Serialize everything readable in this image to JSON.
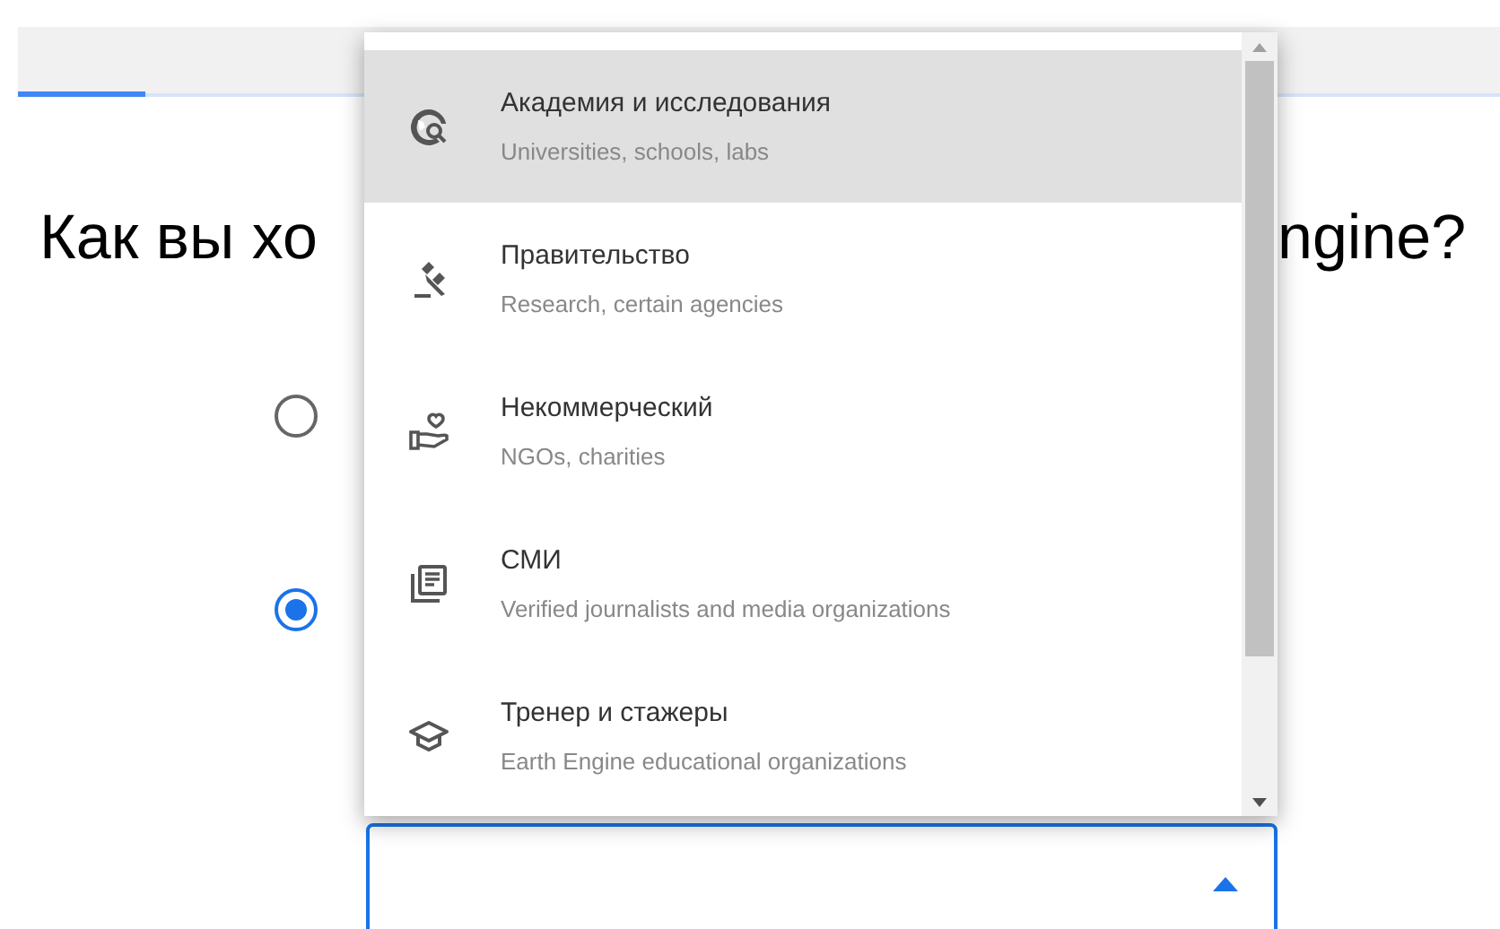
{
  "tabs_bar": {
    "active_indicator": true
  },
  "heading": {
    "visible_left": "Как вы хо",
    "visible_right": "ngine?"
  },
  "radios": [
    {
      "selected": false
    },
    {
      "selected": true
    }
  ],
  "dropdown_menu": {
    "items": [
      {
        "kind": "academia",
        "title": "Академия и исследования",
        "subtitle": "Universities, schools, labs",
        "selected": true
      },
      {
        "kind": "government",
        "title": "Правительство",
        "subtitle": "Research, certain agencies",
        "selected": false
      },
      {
        "kind": "nonprofit",
        "title": "Некоммерческий",
        "subtitle": "NGOs, charities",
        "selected": false
      },
      {
        "kind": "media",
        "title": "СМИ",
        "subtitle": "Verified journalists and media organizations",
        "selected": false
      },
      {
        "kind": "training",
        "title": "Тренер и стажеры",
        "subtitle": "Earth Engine educational organizations",
        "selected": false
      }
    ]
  },
  "select_field": {
    "expanded": true
  }
}
